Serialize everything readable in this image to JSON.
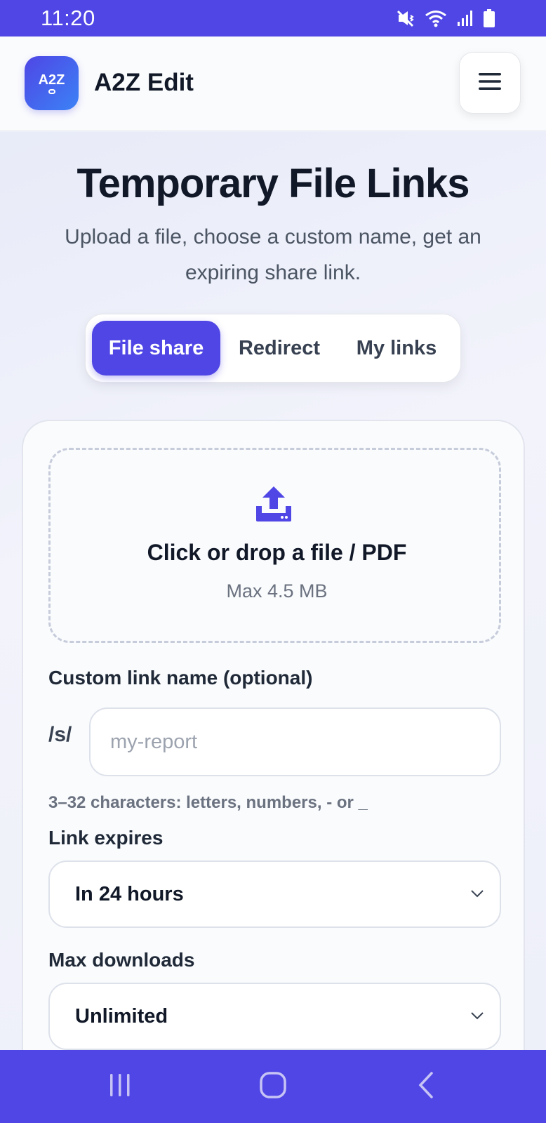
{
  "status_bar": {
    "time": "11:20",
    "icons": [
      "mute-vibrate-icon",
      "wifi-icon",
      "signal-icon",
      "battery-icon"
    ]
  },
  "header": {
    "logo_text": "A2Z",
    "app_name": "A2Z Edit",
    "menu_icon": "hamburger-menu-icon"
  },
  "hero": {
    "title": "Temporary File Links",
    "subtitle": "Upload a file, choose a custom name, get an expiring share link."
  },
  "tabs": [
    {
      "label": "File share",
      "active": true
    },
    {
      "label": "Redirect",
      "active": false
    },
    {
      "label": "My links",
      "active": false
    }
  ],
  "dropzone": {
    "icon": "upload-icon",
    "title": "Click or drop a file / PDF",
    "hint": "Max 4.5 MB"
  },
  "custom_name": {
    "label": "Custom link name (optional)",
    "prefix": "/s/",
    "value": "",
    "placeholder": "my-report",
    "helper": "3–32 characters: letters, numbers, - or _"
  },
  "expires": {
    "label": "Link expires",
    "selected": "In 24 hours"
  },
  "max_downloads": {
    "label": "Max downloads",
    "selected": "Unlimited"
  },
  "colors": {
    "accent": "#4f46e5",
    "text": "#111827",
    "muted": "#6b7280"
  },
  "nav_bar": {
    "icons": [
      "recent-apps-icon",
      "home-icon",
      "back-icon"
    ]
  }
}
